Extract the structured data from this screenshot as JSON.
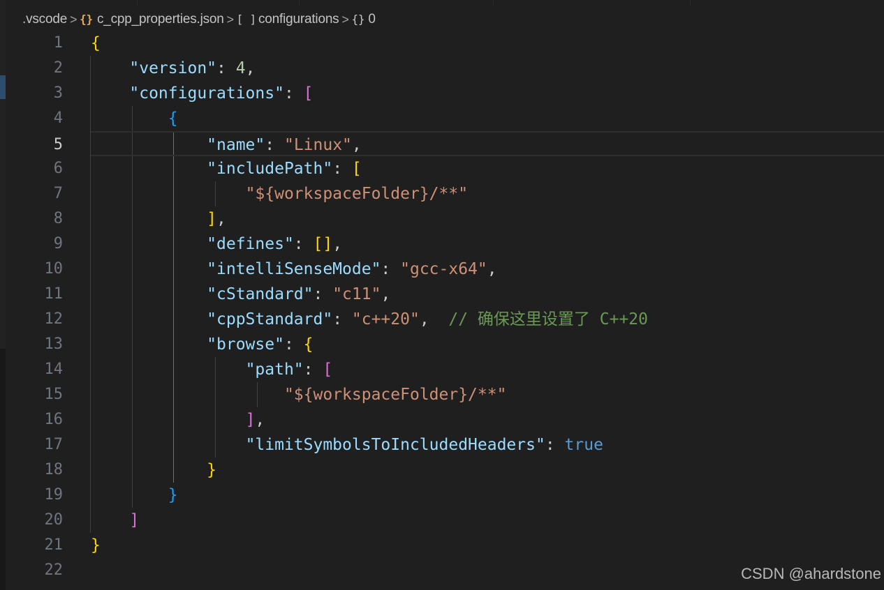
{
  "breadcrumb": {
    "items": [
      {
        "label": ".vscode",
        "icon": ""
      },
      {
        "label": "c_cpp_properties.json",
        "icon": "{}"
      },
      {
        "label": "configurations",
        "icon": "[ ]"
      },
      {
        "label": "0",
        "icon": "{}"
      }
    ],
    "separator": ">"
  },
  "editor": {
    "current_line": 5,
    "line_numbers": [
      "1",
      "2",
      "3",
      "4",
      "5",
      "6",
      "7",
      "8",
      "9",
      "10",
      "11",
      "12",
      "13",
      "14",
      "15",
      "16",
      "17",
      "18",
      "19",
      "20",
      "21",
      "22"
    ],
    "lines": [
      [
        {
          "t": "{",
          "c": "b1"
        }
      ],
      [
        {
          "t": "    "
        },
        {
          "t": "\"version\"",
          "c": "k"
        },
        {
          "t": ": ",
          "c": "p"
        },
        {
          "t": "4",
          "c": "n"
        },
        {
          "t": ",",
          "c": "p"
        }
      ],
      [
        {
          "t": "    "
        },
        {
          "t": "\"configurations\"",
          "c": "k"
        },
        {
          "t": ": ",
          "c": "p"
        },
        {
          "t": "[",
          "c": "b2"
        }
      ],
      [
        {
          "t": "        "
        },
        {
          "t": "{",
          "c": "b3"
        }
      ],
      [
        {
          "t": "            "
        },
        {
          "t": "\"name\"",
          "c": "k"
        },
        {
          "t": ": ",
          "c": "p"
        },
        {
          "t": "\"Linux\"",
          "c": "s"
        },
        {
          "t": ",",
          "c": "p"
        }
      ],
      [
        {
          "t": "            "
        },
        {
          "t": "\"includePath\"",
          "c": "k"
        },
        {
          "t": ": ",
          "c": "p"
        },
        {
          "t": "[",
          "c": "b1"
        }
      ],
      [
        {
          "t": "                "
        },
        {
          "t": "\"${workspaceFolder}/**\"",
          "c": "s"
        }
      ],
      [
        {
          "t": "            "
        },
        {
          "t": "]",
          "c": "b1"
        },
        {
          "t": ",",
          "c": "p"
        }
      ],
      [
        {
          "t": "            "
        },
        {
          "t": "\"defines\"",
          "c": "k"
        },
        {
          "t": ": ",
          "c": "p"
        },
        {
          "t": "[]",
          "c": "b1"
        },
        {
          "t": ",",
          "c": "p"
        }
      ],
      [
        {
          "t": "            "
        },
        {
          "t": "\"intelliSenseMode\"",
          "c": "k"
        },
        {
          "t": ": ",
          "c": "p"
        },
        {
          "t": "\"gcc-x64\"",
          "c": "s"
        },
        {
          "t": ",",
          "c": "p"
        }
      ],
      [
        {
          "t": "            "
        },
        {
          "t": "\"cStandard\"",
          "c": "k"
        },
        {
          "t": ": ",
          "c": "p"
        },
        {
          "t": "\"c11\"",
          "c": "s"
        },
        {
          "t": ",",
          "c": "p"
        }
      ],
      [
        {
          "t": "            "
        },
        {
          "t": "\"cppStandard\"",
          "c": "k"
        },
        {
          "t": ": ",
          "c": "p"
        },
        {
          "t": "\"c++20\"",
          "c": "s"
        },
        {
          "t": ",  ",
          "c": "p"
        },
        {
          "t": "// 确保这里设置了 C++20",
          "c": "cm"
        }
      ],
      [
        {
          "t": "            "
        },
        {
          "t": "\"browse\"",
          "c": "k"
        },
        {
          "t": ": ",
          "c": "p"
        },
        {
          "t": "{",
          "c": "b1"
        }
      ],
      [
        {
          "t": "                "
        },
        {
          "t": "\"path\"",
          "c": "k"
        },
        {
          "t": ": ",
          "c": "p"
        },
        {
          "t": "[",
          "c": "b2"
        }
      ],
      [
        {
          "t": "                    "
        },
        {
          "t": "\"${workspaceFolder}/**\"",
          "c": "s"
        }
      ],
      [
        {
          "t": "                "
        },
        {
          "t": "]",
          "c": "b2"
        },
        {
          "t": ",",
          "c": "p"
        }
      ],
      [
        {
          "t": "                "
        },
        {
          "t": "\"limitSymbolsToIncludedHeaders\"",
          "c": "k"
        },
        {
          "t": ": ",
          "c": "p"
        },
        {
          "t": "true",
          "c": "kw"
        }
      ],
      [
        {
          "t": "            "
        },
        {
          "t": "}",
          "c": "b1"
        }
      ],
      [
        {
          "t": "        "
        },
        {
          "t": "}",
          "c": "b3"
        }
      ],
      [
        {
          "t": "    "
        },
        {
          "t": "]",
          "c": "b2"
        }
      ],
      [
        {
          "t": "}",
          "c": "b1"
        }
      ],
      []
    ]
  },
  "watermark": "CSDN @ahardstone",
  "colors": {
    "background": "#1f1f1f",
    "property_key": "#9cdcfe",
    "string": "#ce9178",
    "number": "#b5cea8",
    "keyword": "#569cd6",
    "comment": "#6a9955",
    "bracket_level_1": "#ffd700",
    "bracket_level_2": "#da70d6",
    "bracket_level_3": "#179fff"
  }
}
